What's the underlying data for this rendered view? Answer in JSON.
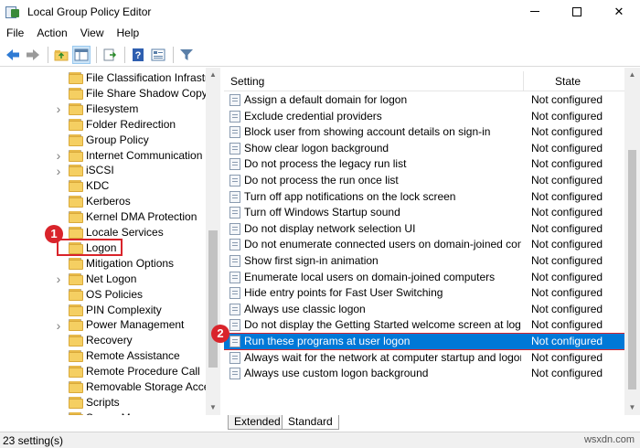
{
  "window": {
    "title": "Local Group Policy Editor",
    "minimize_glyph": "",
    "maximize_glyph": "",
    "close_glyph": "✕"
  },
  "menu": [
    "File",
    "Action",
    "View",
    "Help"
  ],
  "toolbar": {
    "icons": [
      "back-arrow-icon",
      "forward-arrow-icon",
      "folder-up-icon",
      "show-hide-tree-icon",
      "export-list-icon",
      "help-icon",
      "properties-icon",
      "filter-icon"
    ]
  },
  "tree": {
    "items": [
      {
        "label": "File Classification Infrastru",
        "expandable": false
      },
      {
        "label": "File Share Shadow Copy Pr",
        "expandable": false
      },
      {
        "label": "Filesystem",
        "expandable": true
      },
      {
        "label": "Folder Redirection",
        "expandable": false
      },
      {
        "label": "Group Policy",
        "expandable": false
      },
      {
        "label": "Internet Communication M",
        "expandable": true
      },
      {
        "label": "iSCSI",
        "expandable": true
      },
      {
        "label": "KDC",
        "expandable": false
      },
      {
        "label": "Kerberos",
        "expandable": false
      },
      {
        "label": "Kernel DMA Protection",
        "expandable": false
      },
      {
        "label": "Locale Services",
        "expandable": false
      },
      {
        "label": "Logon",
        "expandable": false
      },
      {
        "label": "Mitigation Options",
        "expandable": false
      },
      {
        "label": "Net Logon",
        "expandable": true
      },
      {
        "label": "OS Policies",
        "expandable": false
      },
      {
        "label": "PIN Complexity",
        "expandable": false
      },
      {
        "label": "Power Management",
        "expandable": true
      },
      {
        "label": "Recovery",
        "expandable": false
      },
      {
        "label": "Remote Assistance",
        "expandable": false
      },
      {
        "label": "Remote Procedure Call",
        "expandable": false
      },
      {
        "label": "Removable Storage Access",
        "expandable": false
      },
      {
        "label": "Scripts",
        "expandable": false
      },
      {
        "label": "Server Manager",
        "expandable": false
      }
    ]
  },
  "settings": {
    "columns": {
      "setting": "Setting",
      "state": "State"
    },
    "rows": [
      {
        "name": "Assign a default domain for logon",
        "state": "Not configured"
      },
      {
        "name": "Exclude credential providers",
        "state": "Not configured"
      },
      {
        "name": "Block user from showing account details on sign-in",
        "state": "Not configured"
      },
      {
        "name": "Show clear logon background",
        "state": "Not configured"
      },
      {
        "name": "Do not process the legacy run list",
        "state": "Not configured"
      },
      {
        "name": "Do not process the run once list",
        "state": "Not configured"
      },
      {
        "name": "Turn off app notifications on the lock screen",
        "state": "Not configured"
      },
      {
        "name": "Turn off Windows Startup sound",
        "state": "Not configured"
      },
      {
        "name": "Do not display network selection UI",
        "state": "Not configured"
      },
      {
        "name": "Do not enumerate connected users on domain-joined com...",
        "state": "Not configured"
      },
      {
        "name": "Show first sign-in animation",
        "state": "Not configured"
      },
      {
        "name": "Enumerate local users on domain-joined computers",
        "state": "Not configured"
      },
      {
        "name": "Hide entry points for Fast User Switching",
        "state": "Not configured"
      },
      {
        "name": "Always use classic logon",
        "state": "Not configured"
      },
      {
        "name": "Do not display the Getting Started welcome screen at logon",
        "state": "Not configured"
      },
      {
        "name": "Run these programs at user logon",
        "state": "Not configured",
        "selected": true
      },
      {
        "name": "Always wait for the network at computer startup and logon",
        "state": "Not configured"
      },
      {
        "name": "Always use custom logon background",
        "state": "Not configured"
      }
    ]
  },
  "tabs": [
    "Extended",
    "Standard"
  ],
  "status": {
    "text": "23 setting(s)"
  },
  "watermark": "wsxdn.com",
  "callouts": {
    "step1": "1",
    "step2": "2"
  },
  "colors": {
    "highlight": "#d9242b",
    "selection": "#0078d7"
  }
}
